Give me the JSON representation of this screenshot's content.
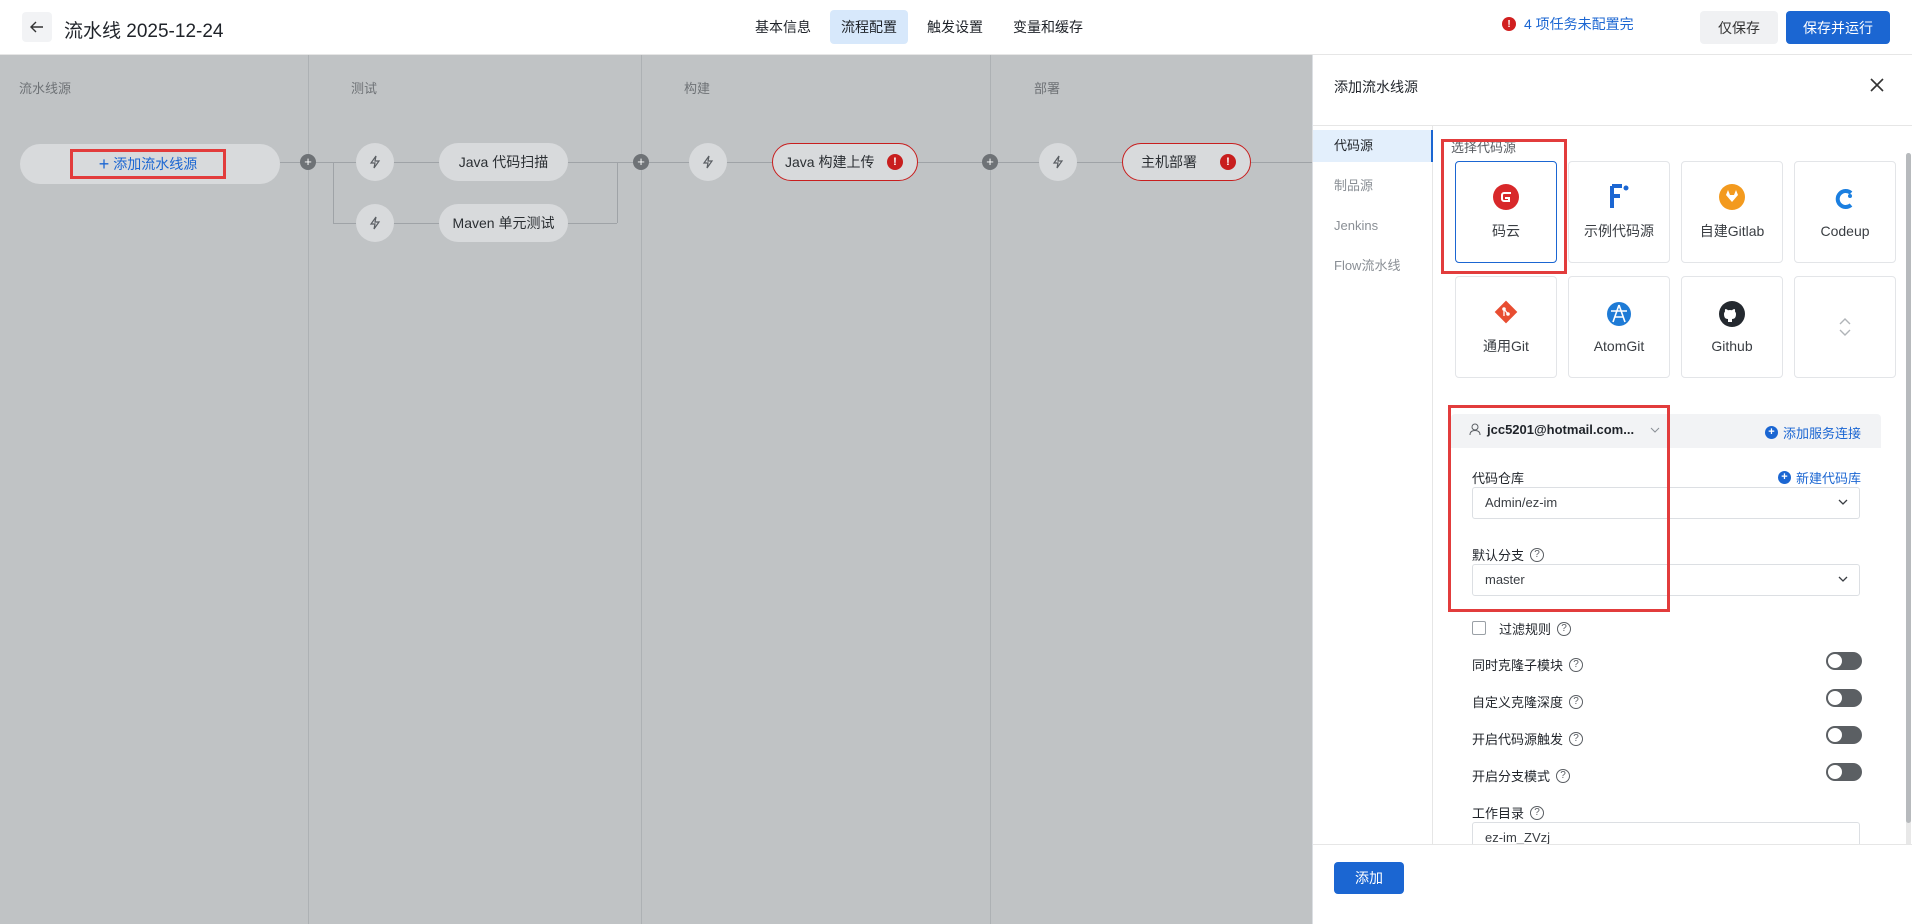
{
  "header": {
    "title": "流水线 2025-12-24",
    "tabs": [
      {
        "label": "基本信息",
        "active": false
      },
      {
        "label": "流程配置",
        "active": true
      },
      {
        "label": "触发设置",
        "active": false
      },
      {
        "label": "变量和缓存",
        "active": false
      }
    ],
    "warning_text": "4 项任务未配置完",
    "warning_icon": "!",
    "save_only_label": "仅保存",
    "save_run_label": "保存并运行"
  },
  "canvas": {
    "stages": [
      {
        "title": "流水线源"
      },
      {
        "title": "测试"
      },
      {
        "title": "构建"
      },
      {
        "title": "部署"
      }
    ],
    "add_source_label": "添加流水线源",
    "add_source_plus": "+",
    "tasks": {
      "java_scan": "Java 代码扫描",
      "maven_test": "Maven 单元测试",
      "java_build": "Java 构建上传",
      "host_deploy": "主机部署"
    },
    "error_badge": "!"
  },
  "panel": {
    "title": "添加流水线源",
    "nav": [
      {
        "label": "代码源",
        "active": true
      },
      {
        "label": "制品源",
        "active": false
      },
      {
        "label": "Jenkins",
        "active": false
      },
      {
        "label": "Flow流水线",
        "active": false
      }
    ],
    "choose_label": "选择代码源",
    "sources": [
      {
        "label": "码云",
        "icon": "gitee-icon",
        "selected": true
      },
      {
        "label": "示例代码源",
        "icon": "sample-source-icon",
        "selected": false
      },
      {
        "label": "自建Gitlab",
        "icon": "gitlab-icon",
        "selected": false
      },
      {
        "label": "Codeup",
        "icon": "codeup-icon",
        "selected": false
      },
      {
        "label": "通用Git",
        "icon": "git-icon",
        "selected": false
      },
      {
        "label": "AtomGit",
        "icon": "atomgit-icon",
        "selected": false
      },
      {
        "label": "Github",
        "icon": "github-icon",
        "selected": false
      },
      {
        "label": "",
        "icon": "expand-icon",
        "selected": false
      }
    ],
    "account": "jcc5201@hotmail.com...",
    "add_service_link": "添加服务连接",
    "repo_label": "代码仓库",
    "new_repo_link": "新建代码库",
    "repo_value": "Admin/ez-im",
    "branch_label": "默认分支",
    "branch_value": "master",
    "filter_label": "过滤规则",
    "toggles": [
      {
        "label": "同时克隆子模块",
        "on": false
      },
      {
        "label": "自定义克隆深度",
        "on": false
      },
      {
        "label": "开启代码源触发",
        "on": false
      },
      {
        "label": "开启分支模式",
        "on": false
      }
    ],
    "workdir_label": "工作目录",
    "workdir_value": "ez-im_ZVzj",
    "help_glyph": "?",
    "add_button": "添加",
    "plus_glyph": "+",
    "colors": {
      "accent": "#1b66d2",
      "error": "#c81e1e",
      "highlight": "#e23c3c"
    }
  }
}
